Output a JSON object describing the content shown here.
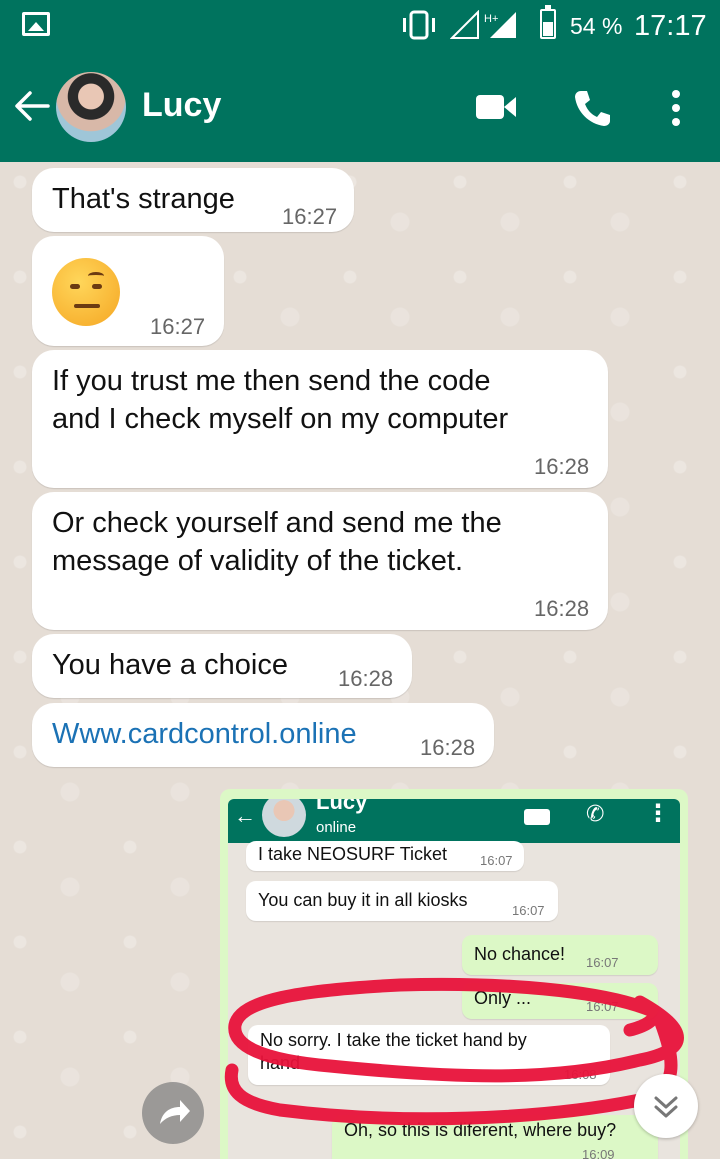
{
  "status_bar": {
    "battery_percent": "54 %",
    "time": "17:17"
  },
  "header": {
    "contact_name": "Lucy"
  },
  "messages": [
    {
      "text": "That's strange",
      "time": "16:27"
    },
    {
      "emoji": "face-with-raised-eyebrow",
      "time": "16:27"
    },
    {
      "text_line1": "If you trust me then send the code",
      "text_line2": "and I check myself on my computer",
      "time": "16:28"
    },
    {
      "text_line1": "Or check yourself and send me the",
      "text_line2": "message of validity of the ticket.",
      "time": "16:28"
    },
    {
      "text": "You have a choice",
      "time": "16:28"
    },
    {
      "text": "Www.cardcontrol.online",
      "time": "16:28"
    }
  ],
  "screenshot": {
    "contact_name": "Lucy",
    "contact_status": "online",
    "messages": [
      {
        "text": "I take NEOSURF Ticket",
        "time": "16:07",
        "direction": "in"
      },
      {
        "text": "You can buy it in all kiosks",
        "time": "16:07",
        "direction": "in"
      },
      {
        "text": "No chance!",
        "time": "16:07",
        "direction": "out"
      },
      {
        "text": "Only ...",
        "time": "16:07",
        "direction": "out"
      },
      {
        "text_line1": "No sorry. I take the ticket hand by",
        "text_line2": "hand",
        "time": "16:08",
        "direction": "in"
      },
      {
        "text": "Oh, so this is diferent, where buy?",
        "time": "16:09",
        "direction": "out"
      }
    ]
  },
  "colors": {
    "header": "#00735e",
    "chat_bg": "#e5ddd5",
    "outgoing": "#dcf8c6",
    "link": "#1b72b5",
    "annotation": "#e8123a"
  }
}
